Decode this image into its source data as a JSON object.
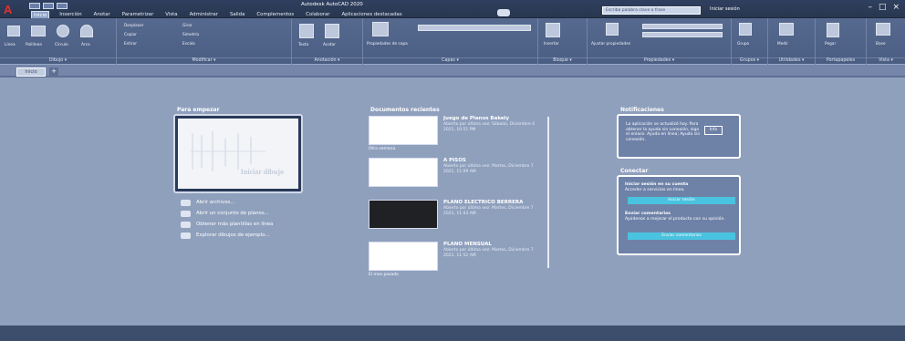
{
  "app": {
    "title": "Autodesk AutoCAD 2020",
    "logo": "A"
  },
  "tabs": [
    "Inicio",
    "Inserción",
    "Anotar",
    "Parametrizar",
    "Vista",
    "Administrar",
    "Salida",
    "Complementos",
    "Colaborar",
    "Aplicaciones destacadas"
  ],
  "search": {
    "placeholder": "Escriba palabra clave o frase"
  },
  "user": {
    "label": "Iniciar sesión"
  },
  "ribbon": {
    "panels": [
      "Dibujo ▾",
      "Modificar ▾",
      "Anotación ▾",
      "Capas ▾",
      "Bloque ▾",
      "Propiedades ▾",
      "Grupos ▾",
      "Utilidades ▾",
      "Portapapeles",
      "Vista ▾"
    ],
    "labels": [
      "Línea",
      "Polilínea",
      "Círculo",
      "Arco",
      "Desplazar",
      "Copiar",
      "Estirar",
      "Girar",
      "Simetría",
      "Escala",
      "Texto",
      "Acotar",
      "Propiedades de capa",
      "Insertar",
      "Ajustar propiedades",
      "Grupo",
      "Medir",
      "Pegar",
      "Base"
    ]
  },
  "file_tab": {
    "label": "Inicio",
    "new": "+"
  },
  "start": {
    "title": "Para empezar",
    "preview_text": "Iniciar dibujo",
    "links": [
      "Abrir archivos...",
      "Abrir un conjunto de planos...",
      "Obtener más plantillas en línea",
      "Explorar dibujos de ejemplo..."
    ]
  },
  "recent": {
    "title": "Documentos recientes",
    "items": [
      {
        "name": "Juego de Planos Bakely",
        "meta": "Abierto por última vez: Sábado, Diciembre 4 2021, 10:51 PM",
        "group": "Otra semana"
      },
      {
        "name": "A PISOS",
        "meta": "Abierto por última vez: Martes, Diciembre 7 2021, 11:09 AM",
        "group": ""
      },
      {
        "name": "PLANO ELECTRICO BERRERA",
        "meta": "Abierto por última vez: Martes, Diciembre 7 2021, 11:43 AM",
        "group": ""
      },
      {
        "name": "PLANO MENSUAL",
        "meta": "Abierto por última vez: Martes, Diciembre 7 2021, 11:52 AM",
        "group": "El mes pasado"
      }
    ]
  },
  "notifications": {
    "title": "Notificaciones",
    "text": "La aplicación se actualizó hoy. Para obtener la ayuda sin conexión, siga el enlace. Ayuda en línea; Ayuda sin conexión.",
    "button": "Info"
  },
  "connect": {
    "title": "Conectar",
    "signin_title": "Iniciar sesión en su cuenta",
    "signin_text": "Acceder a servicios en línea.",
    "signin_button": "Iniciar sesión",
    "feedback_title": "Enviar comentarios",
    "feedback_text": "Ayúdenos a mejorar el producto con su opinión.",
    "feedback_button": "Enviar comentarios"
  }
}
